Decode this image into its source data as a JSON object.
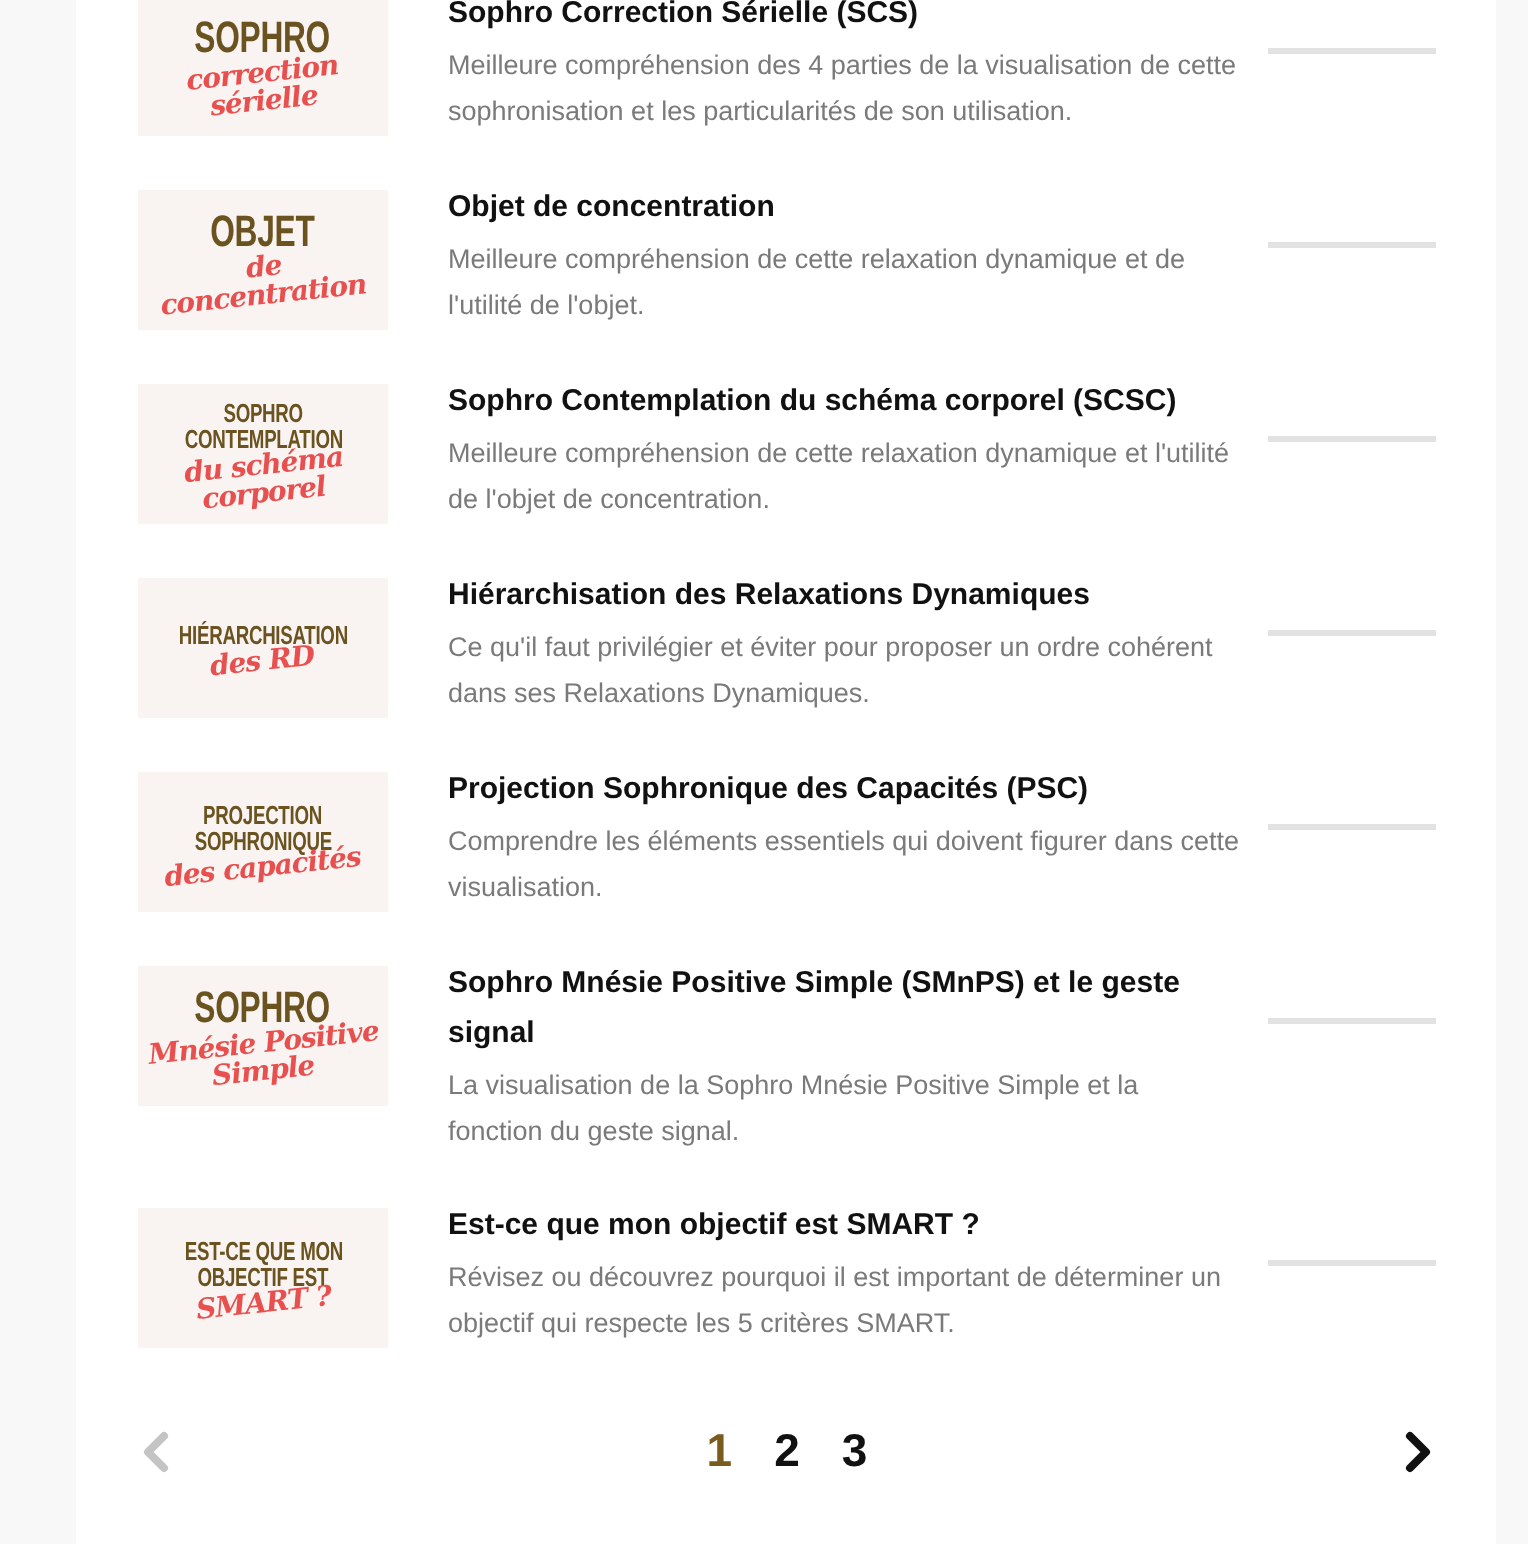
{
  "courses": [
    {
      "thumbnail": [
        {
          "kind": "block",
          "text": "SOPHRO"
        },
        {
          "kind": "script",
          "text": "correction"
        },
        {
          "kind": "script",
          "text": "sérielle"
        }
      ],
      "title": "Sophro Correction Sérielle (SCS)",
      "description": "Meilleure compréhension des 4 parties de la visualisation de cette sophronisation et les particularités de son utilisation."
    },
    {
      "thumbnail": [
        {
          "kind": "block",
          "text": "OBJET"
        },
        {
          "kind": "script",
          "text": "de"
        },
        {
          "kind": "script",
          "text": "concentration"
        }
      ],
      "title": "Objet de concentration",
      "description": "Meilleure compréhension de cette relaxation dynamique et de l'utilité de l'objet."
    },
    {
      "thumbnail": [
        {
          "kind": "block",
          "text": "SOPHRO"
        },
        {
          "kind": "block",
          "text": "CONTEMPLATION"
        },
        {
          "kind": "script",
          "text": "du schéma"
        },
        {
          "kind": "script",
          "text": "corporel"
        }
      ],
      "title": "Sophro Contemplation du schéma corporel (SCSC)",
      "description": "Meilleure compréhension de cette relaxation dynamique et l'utilité de l'objet de concentration."
    },
    {
      "thumbnail": [
        {
          "kind": "block",
          "text": "HIÉRARCHISATION"
        },
        {
          "kind": "script",
          "text": "des RD"
        }
      ],
      "title": "Hiérarchisation des Relaxations Dynamiques",
      "description": "Ce qu'il faut privilégier et éviter pour proposer un ordre cohérent dans ses Relaxations Dynamiques."
    },
    {
      "thumbnail": [
        {
          "kind": "block",
          "text": "PROJECTION"
        },
        {
          "kind": "block",
          "text": "SOPHRONIQUE"
        },
        {
          "kind": "script",
          "text": "des capacités"
        }
      ],
      "title": "Projection Sophronique des Capacités (PSC)",
      "description": "Comprendre les éléments essentiels qui doivent figurer dans cette visualisation."
    },
    {
      "thumbnail": [
        {
          "kind": "block",
          "text": "SOPHRO"
        },
        {
          "kind": "script",
          "text": "Mnésie Positive"
        },
        {
          "kind": "script",
          "text": "Simple"
        }
      ],
      "title": "Sophro Mnésie Positive Simple (SMnPS) et le geste signal",
      "description": "La visualisation de la Sophro Mnésie Positive Simple et la fonction du geste signal."
    },
    {
      "thumbnail": [
        {
          "kind": "block",
          "text": "EST-CE QUE MON"
        },
        {
          "kind": "block",
          "text": "OBJECTIF EST"
        },
        {
          "kind": "script",
          "text": "SMART ?"
        }
      ],
      "title": "Est-ce que mon objectif est SMART ?",
      "description": "Révisez ou découvrez pourquoi il est important de déterminer un objectif qui respecte les 5 critères SMART."
    }
  ],
  "pagination": {
    "previous": {
      "disabled": true
    },
    "pages": [
      {
        "label": "1",
        "selected": true
      },
      {
        "label": "2",
        "selected": false
      },
      {
        "label": "3",
        "selected": false
      }
    ],
    "next": {
      "disabled": false
    }
  }
}
